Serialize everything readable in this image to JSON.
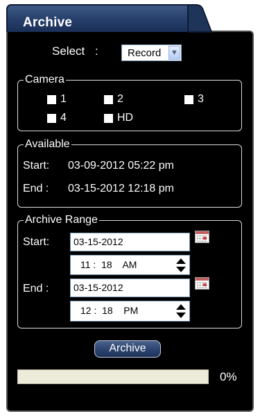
{
  "tab": {
    "title": "Archive"
  },
  "select": {
    "label": "Select",
    "colon": ":",
    "value": "Record"
  },
  "camera": {
    "legend": "Camera",
    "items": [
      "1",
      "2",
      "3",
      "4",
      "HD"
    ]
  },
  "available": {
    "legend": "Available",
    "start_label": "Start:",
    "start_value": "03-09-2012 05:22 pm",
    "end_label": "End :",
    "end_value": "03-15-2012 12:18 pm"
  },
  "range": {
    "legend": "Archive Range",
    "start_label": "Start:",
    "start_date": "03-15-2012",
    "start_time": "11 :  18    AM",
    "end_label": "End :",
    "end_date": "03-15-2012",
    "end_time": "12 :  18    PM"
  },
  "archive_button": "Archive",
  "progress": {
    "value": 0,
    "label": "0%"
  }
}
